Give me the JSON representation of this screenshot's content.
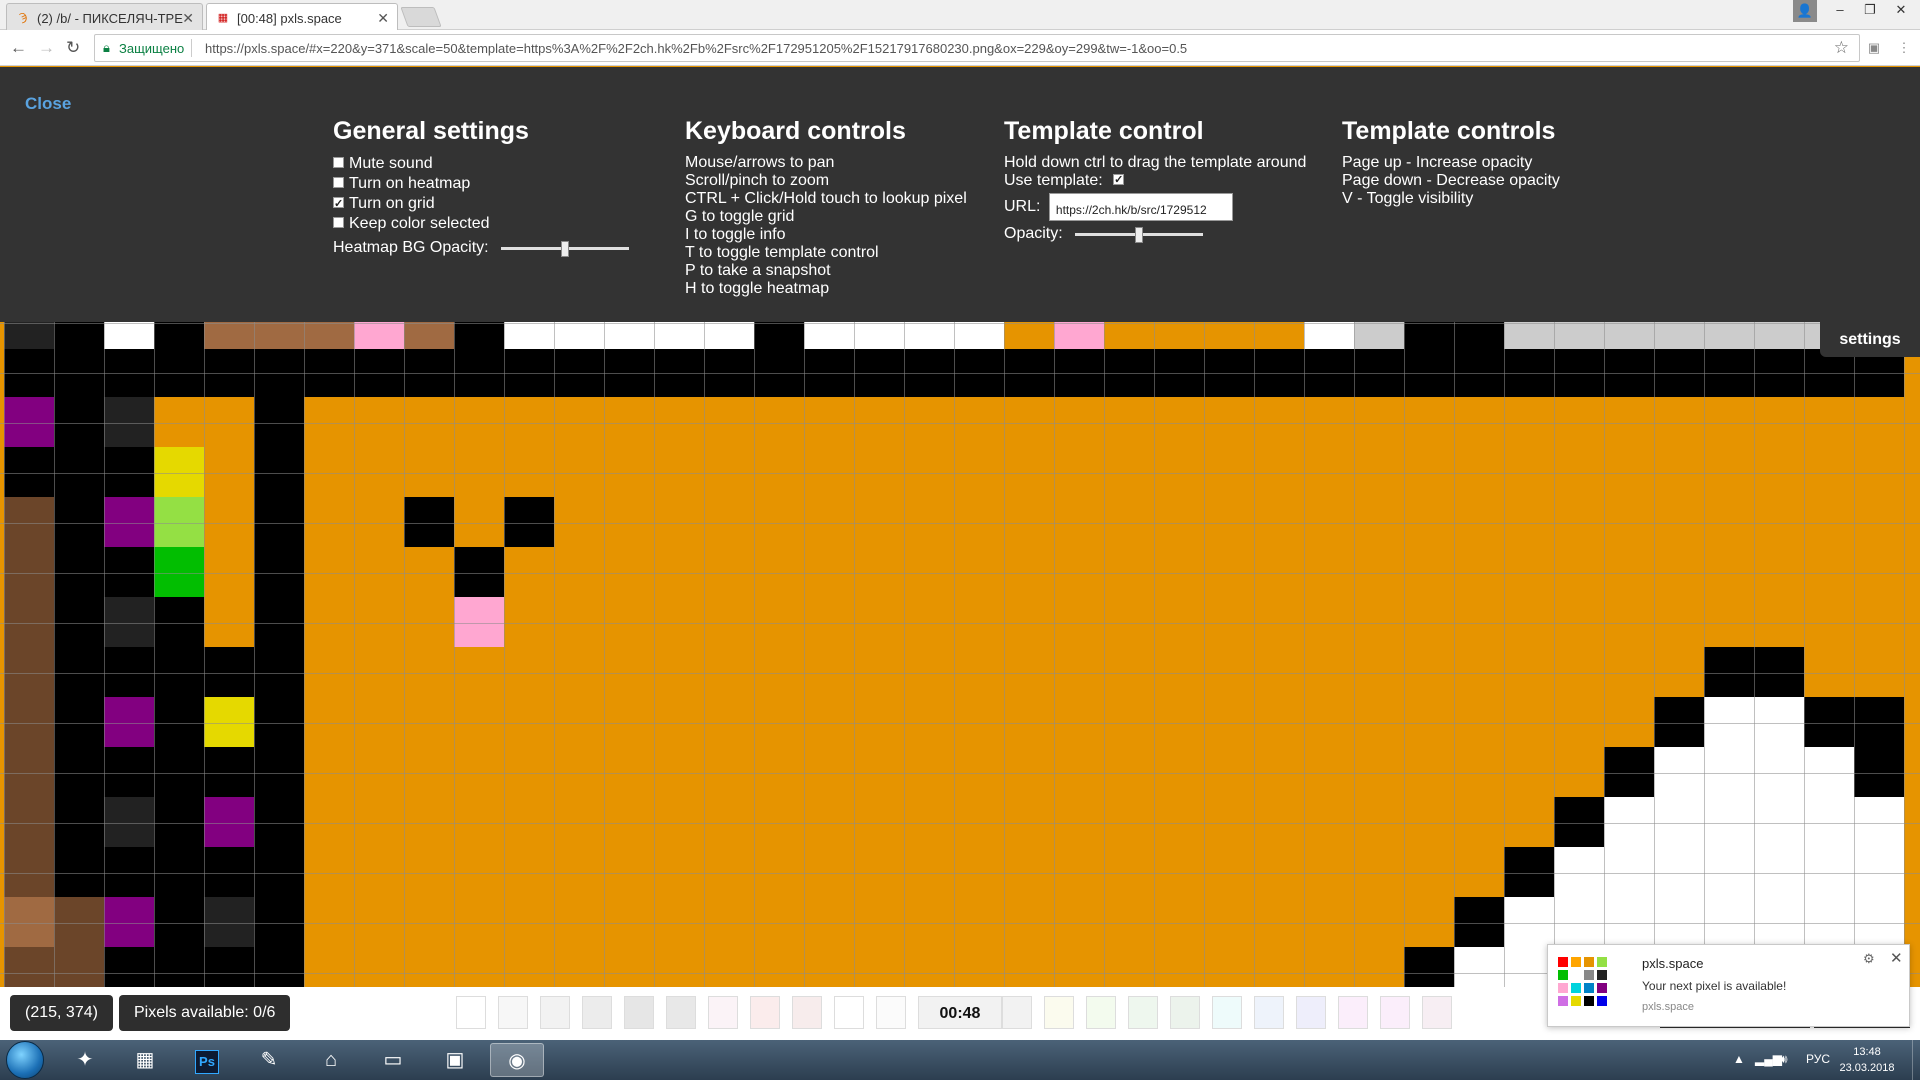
{
  "browser": {
    "tabs": [
      {
        "title": "(2) /b/ - ПИКСЕЛЯЧ-ТРЕ",
        "favicon": "2ch-icon"
      },
      {
        "title": "[00:48] pxls.space",
        "favicon": "pxls-icon"
      }
    ],
    "secure_label": "Защищено",
    "url": "https://pxls.space/#x=220&y=371&scale=50&template=https%3A%2F%2F2ch.hk%2Fb%2Fsrc%2F172951205%2F15217917680230.png&ox=229&oy=299&tw=-1&oo=0.5",
    "window_controls": {
      "minimize": "–",
      "restore": "❐",
      "close": "✕"
    }
  },
  "settings_panel": {
    "close_label": "Close",
    "general": {
      "title": "General settings",
      "options": [
        {
          "label": "Mute sound",
          "checked": false
        },
        {
          "label": "Turn on heatmap",
          "checked": false
        },
        {
          "label": "Turn on grid",
          "checked": true
        },
        {
          "label": "Keep color selected",
          "checked": false
        }
      ],
      "heatmap_opacity_label": "Heatmap BG Opacity:",
      "heatmap_opacity_value": 0.5
    },
    "keyboard": {
      "title": "Keyboard controls",
      "lines": [
        "Mouse/arrows to pan",
        "Scroll/pinch to zoom",
        "CTRL + Click/Hold touch to lookup pixel",
        "G to toggle grid",
        "I to toggle info",
        "T to toggle template control",
        "P to take a snapshot",
        "H to toggle heatmap"
      ]
    },
    "template_control": {
      "title": "Template control",
      "hint": "Hold down ctrl to drag the template around",
      "use_template_label": "Use template:",
      "use_template_checked": true,
      "url_label": "URL:",
      "url_value": "https://2ch.hk/b/src/1729512",
      "opacity_label": "Opacity:",
      "opacity_value": 0.5
    },
    "template_controls": {
      "title": "Template controls",
      "lines": [
        "Page up - Increase opacity",
        "Page down - Decrease opacity",
        "V - Toggle visibility"
      ]
    }
  },
  "settings_button_label": "settings",
  "status": {
    "coords": "(215, 374)",
    "pixels_available": "Pixels available: 0/6",
    "timer": "00:48"
  },
  "palette": [
    "#ffffff",
    "#f7f7f7",
    "#f2f2f2",
    "#ececec",
    "#e6e6e6",
    "#e8e8e8",
    "#fbf3f7",
    "#fbecec",
    "#f7ecec",
    "#ffffff",
    "#fbfbfb",
    "#f2f2f2",
    "#fbfbee",
    "#f3fbee",
    "#eef7ee",
    "#ecf3ec",
    "#eefbfb",
    "#eef3fb",
    "#eeeefb",
    "#fbeefb",
    "#fbeefb",
    "#f7eef3"
  ],
  "colors": {
    "orange": "#e69400",
    "black": "#000000",
    "white": "#ffffff",
    "pink": "#ffa7d1",
    "brown": "#6b4529",
    "tan": "#a06a42",
    "purple": "#820080",
    "yellow": "#e5d900",
    "lightgreen": "#94e044",
    "green": "#02be01",
    "gray": "#cccccc",
    "darkgray": "#222222",
    "accent": "#5aa3e0"
  },
  "notification": {
    "title": "pxls.space",
    "message": "Your next pixel is available!",
    "source": "pxls.space"
  },
  "taskbar": {
    "apps": [
      "battlenet-icon",
      "calculator-icon",
      "photoshop-icon",
      "paint-icon",
      "network-icon",
      "explorer-icon",
      "terminal-icon",
      "chrome-icon"
    ],
    "photoshop_label": "Ps",
    "lang": "РУС",
    "time": "13:48",
    "date": "23.03.2018"
  }
}
